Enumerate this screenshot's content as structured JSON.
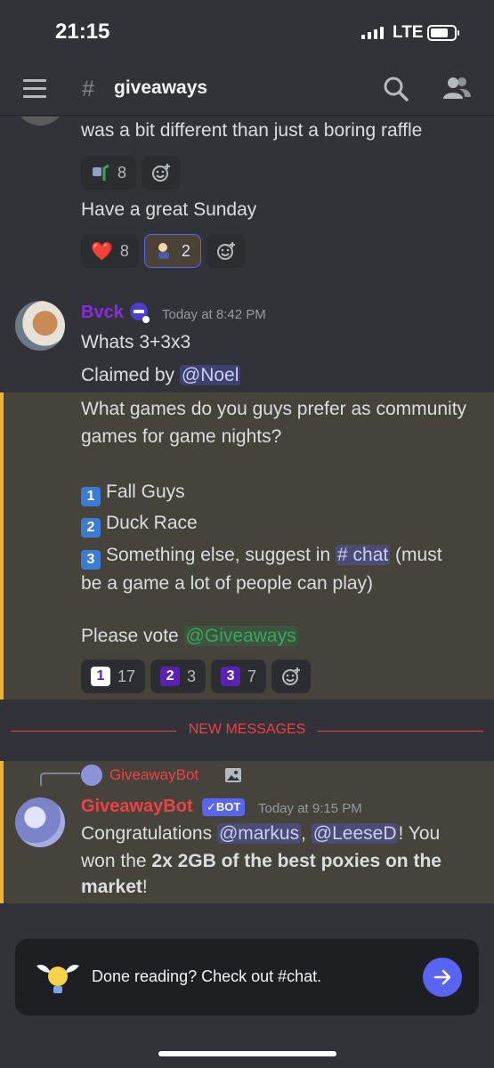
{
  "status_bar": {
    "time": "21:15",
    "network": "LTE"
  },
  "header": {
    "channel": "giveaways"
  },
  "messages": {
    "prev": {
      "line1": "was a bit different than just a boring raffle",
      "reactions1": [
        {
          "count": "8"
        }
      ],
      "line2": "Have a great Sunday",
      "reactions2": [
        {
          "emoji": "❤️",
          "count": "8"
        },
        {
          "count": "2"
        }
      ]
    },
    "bvck": {
      "username": "Bvck",
      "timestamp": "Today at 8:42 PM",
      "line1": "Whats 3+3x3",
      "claimed_prefix": "Claimed by ",
      "claimed_mention": "@Noel",
      "poll_q1": "What games do you guys prefer as community",
      "poll_q2": "games for game nights?",
      "opt1_num": "1",
      "opt1": "Fall Guys",
      "opt2_num": "2",
      "opt2": "Duck Race",
      "opt3_num": "3",
      "opt3a": "Something else, suggest in ",
      "opt3_channel": "# chat",
      "opt3b": " (must",
      "opt3c": "be a game a lot of people can play)",
      "vote_prefix": "Please vote ",
      "vote_mention": "@Giveaways",
      "vote_reactions": [
        {
          "num": "1",
          "count": "17"
        },
        {
          "num": "2",
          "count": "3"
        },
        {
          "num": "3",
          "count": "7"
        }
      ]
    },
    "divider": "NEW MESSAGES",
    "bot": {
      "reply_name": "GiveawayBot",
      "username": "GiveawayBot",
      "tag": "✓BOT",
      "timestamp": "Today at 9:15 PM",
      "l1_prefix": "Congratulations ",
      "l1_m1": "@markus",
      "l1_sep": ", ",
      "l1_m2": "@LeeseD",
      "l1_suffix": "! You",
      "l2_prefix": "won the ",
      "l2_bold": "2x 2GB of the best poxies on the",
      "l3_bold": "market",
      "l3_suffix": "!"
    }
  },
  "banner": {
    "text": "Done reading? Check out #chat."
  },
  "colors": {
    "accent": "#5865f2",
    "bvck": "#8a2be2",
    "bot": "#ed4245",
    "highlight_border": "#f0b232",
    "divider": "#f23f43"
  }
}
